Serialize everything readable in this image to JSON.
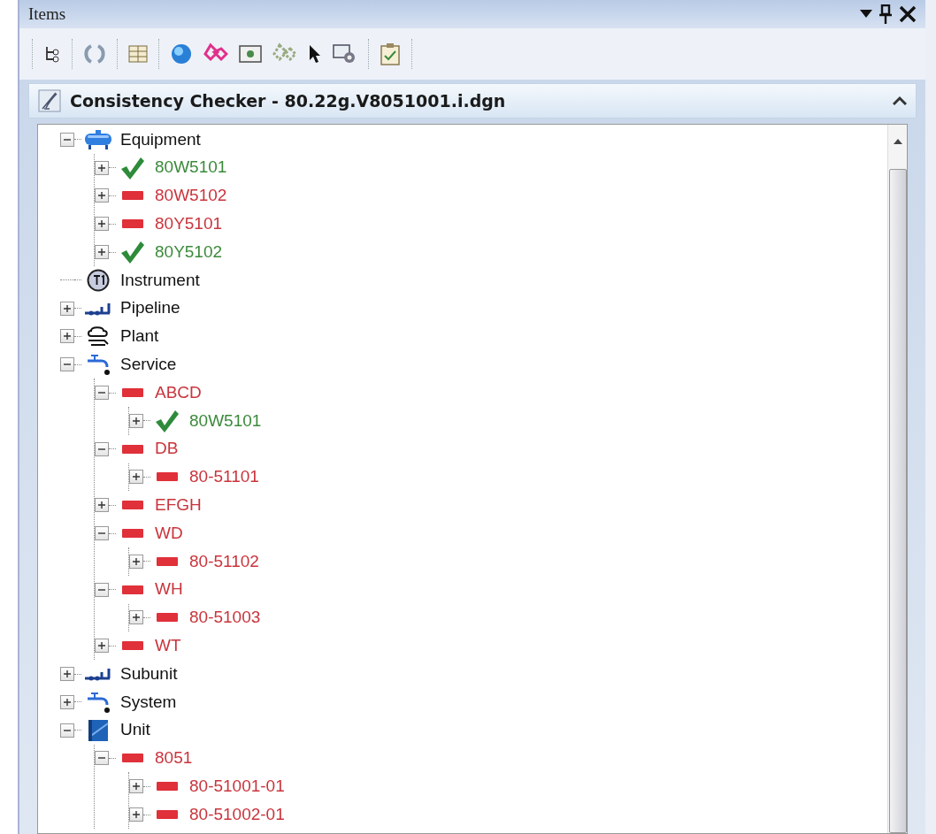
{
  "panel": {
    "title": "Items"
  },
  "header": {
    "title": "Consistency Checker - 80.22g.V8051001.i.dgn",
    "expanded": true
  },
  "tree": [
    {
      "label": "Equipment",
      "kind": "equipment",
      "expanded": true,
      "children": [
        {
          "label": "80W5101",
          "kind": "ok",
          "expanded": false
        },
        {
          "label": "80W5102",
          "kind": "error",
          "expanded": false
        },
        {
          "label": "80Y5101",
          "kind": "error",
          "expanded": false
        },
        {
          "label": "80Y5102",
          "kind": "ok",
          "expanded": false
        }
      ]
    },
    {
      "label": "Instrument",
      "kind": "instrument"
    },
    {
      "label": "Pipeline",
      "kind": "pipeline",
      "expanded": false
    },
    {
      "label": "Plant",
      "kind": "plant",
      "expanded": false
    },
    {
      "label": "Service",
      "kind": "service",
      "expanded": true,
      "children": [
        {
          "label": "ABCD",
          "kind": "error",
          "expanded": true,
          "children": [
            {
              "label": "80W5101",
              "kind": "ok",
              "expanded": false
            }
          ]
        },
        {
          "label": "DB",
          "kind": "error",
          "expanded": true,
          "children": [
            {
              "label": "80-51101",
              "kind": "error",
              "expanded": false
            }
          ]
        },
        {
          "label": "EFGH",
          "kind": "error",
          "expanded": false
        },
        {
          "label": "WD",
          "kind": "error",
          "expanded": true,
          "children": [
            {
              "label": "80-51102",
              "kind": "error",
              "expanded": false
            }
          ]
        },
        {
          "label": "WH",
          "kind": "error",
          "expanded": true,
          "children": [
            {
              "label": "80-51003",
              "kind": "error",
              "expanded": false
            }
          ]
        },
        {
          "label": "WT",
          "kind": "error",
          "expanded": false
        }
      ]
    },
    {
      "label": "Subunit",
      "kind": "pipeline",
      "expanded": false
    },
    {
      "label": "System",
      "kind": "service",
      "expanded": false
    },
    {
      "label": "Unit",
      "kind": "unit",
      "expanded": true,
      "children": [
        {
          "label": "8051",
          "kind": "error",
          "expanded": true,
          "children": [
            {
              "label": "80-51001-01",
              "kind": "error",
              "expanded": false
            },
            {
              "label": "80-51002-01",
              "kind": "error",
              "expanded": false
            }
          ]
        }
      ]
    }
  ]
}
